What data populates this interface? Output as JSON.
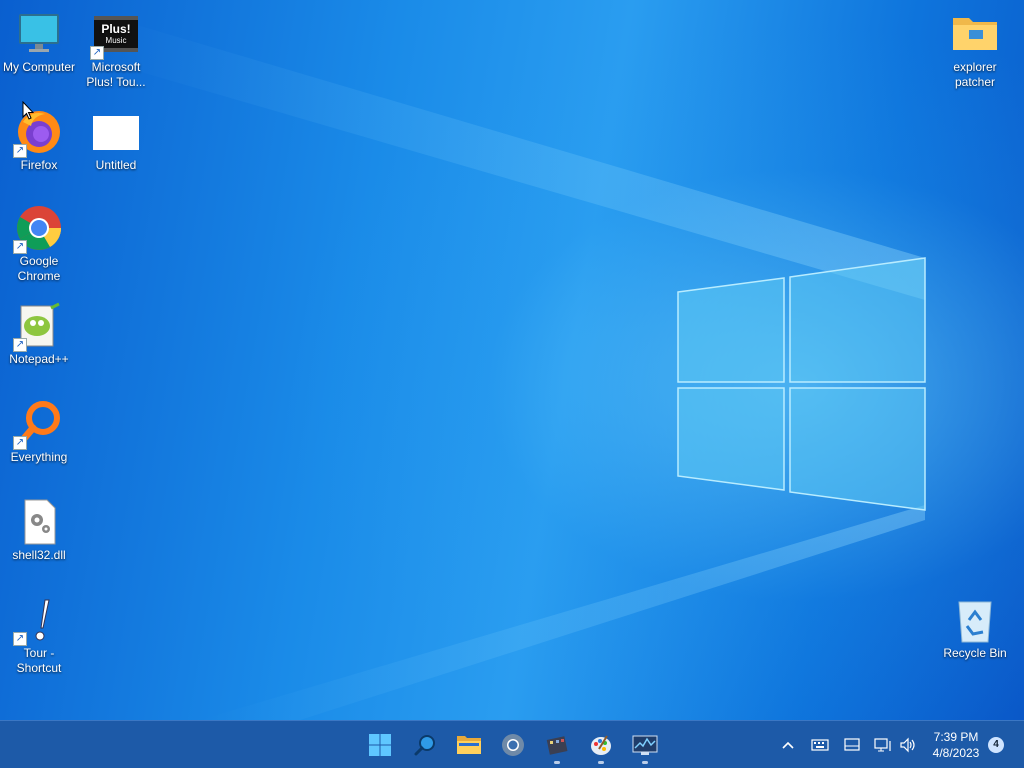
{
  "desktop": {
    "icons": [
      {
        "label": "My Computer"
      },
      {
        "label": "Microsoft Plus! Tou..."
      },
      {
        "label": "Firefox"
      },
      {
        "label": "Untitled"
      },
      {
        "label": "Google Chrome"
      },
      {
        "label": "Notepad++"
      },
      {
        "label": "Everything"
      },
      {
        "label": "shell32.dll"
      },
      {
        "label": "Tour - Shortcut"
      },
      {
        "label": "explorer patcher"
      },
      {
        "label": "Recycle Bin"
      }
    ],
    "plus_badge_top": "Plus!",
    "plus_badge_bottom": "Music"
  },
  "taskbar": {
    "clock_time": "7:39 PM",
    "clock_date": "4/8/2023",
    "notification_count": "4",
    "accent": "#1d5aa8"
  }
}
